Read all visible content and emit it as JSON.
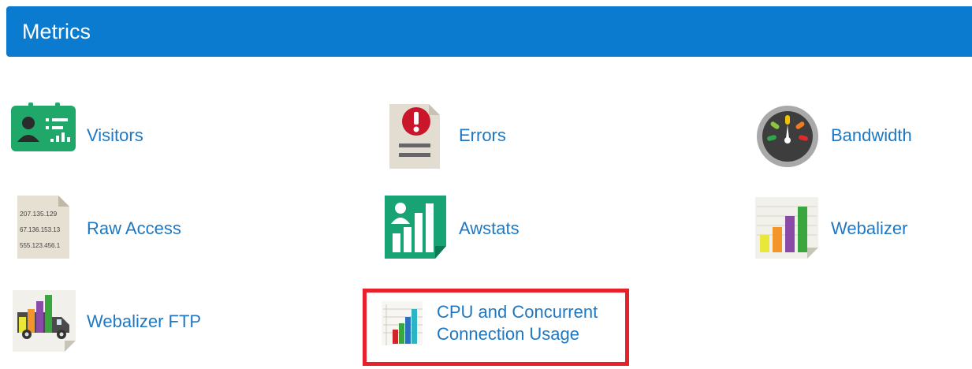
{
  "section": {
    "title": "Metrics"
  },
  "items": [
    {
      "label": "Visitors",
      "icon": "visitors-icon"
    },
    {
      "label": "Errors",
      "icon": "errors-icon"
    },
    {
      "label": "Bandwidth",
      "icon": "bandwidth-icon"
    },
    {
      "label": "Raw Access",
      "icon": "raw-access-icon",
      "icon_text": [
        "207.135.129",
        "67.136.153.13",
        "555.123.456.1"
      ]
    },
    {
      "label": "Awstats",
      "icon": "awstats-icon"
    },
    {
      "label": "Webalizer",
      "icon": "webalizer-icon"
    },
    {
      "label": "Webalizer FTP",
      "icon": "webalizer-ftp-icon"
    },
    {
      "label_line1": "CPU and Concurrent",
      "label_line2": "Connection Usage",
      "icon": "cpu-usage-icon",
      "highlighted": true
    }
  ],
  "colors": {
    "header": "#0b7bd0",
    "link": "#1f78c1",
    "highlight": "#e8202a"
  }
}
